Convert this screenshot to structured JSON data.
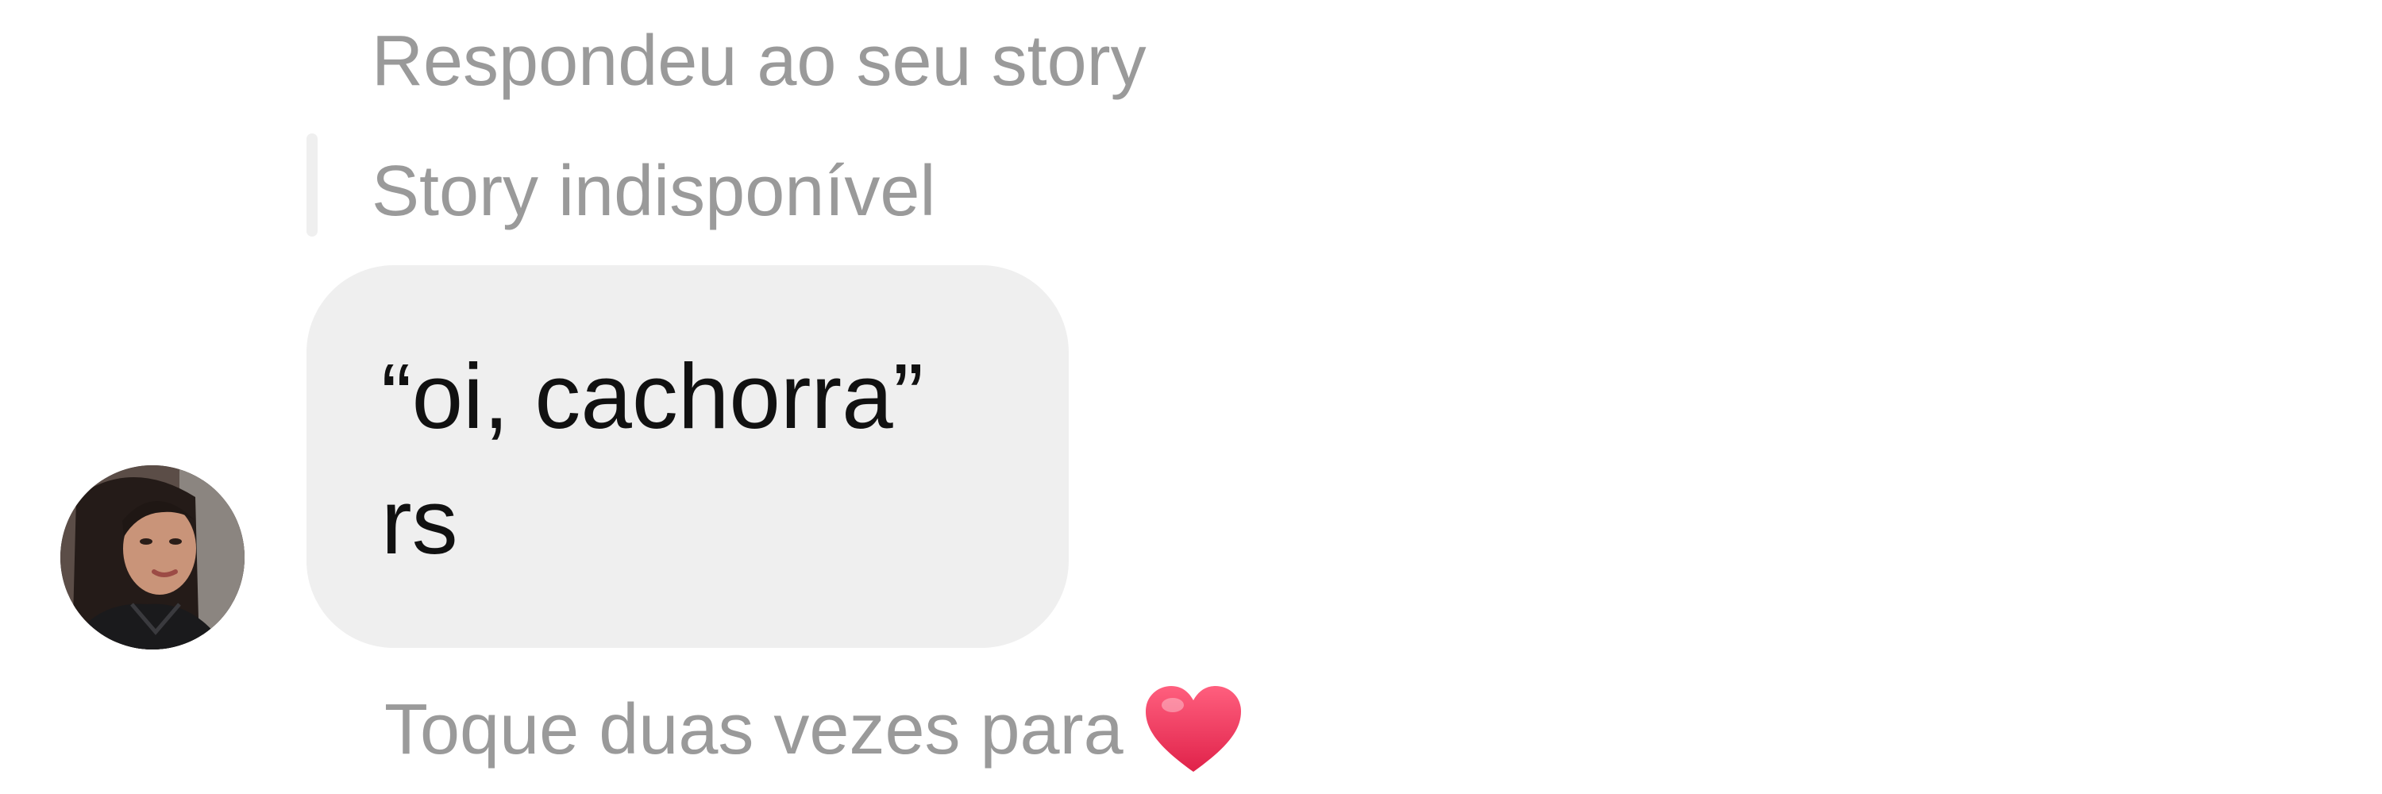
{
  "reply": {
    "header": "Respondeu ao seu story",
    "story_status": "Story indisponível"
  },
  "message": {
    "lines": [
      "“oi, cachorra”",
      "rs"
    ]
  },
  "hint": {
    "text": "Toque duas vezes para",
    "icon": "heart-icon",
    "icon_color": "#f0345a"
  },
  "colors": {
    "bubble": "#efefef",
    "secondary_text": "#9a9a9a",
    "message_text": "#111111"
  }
}
